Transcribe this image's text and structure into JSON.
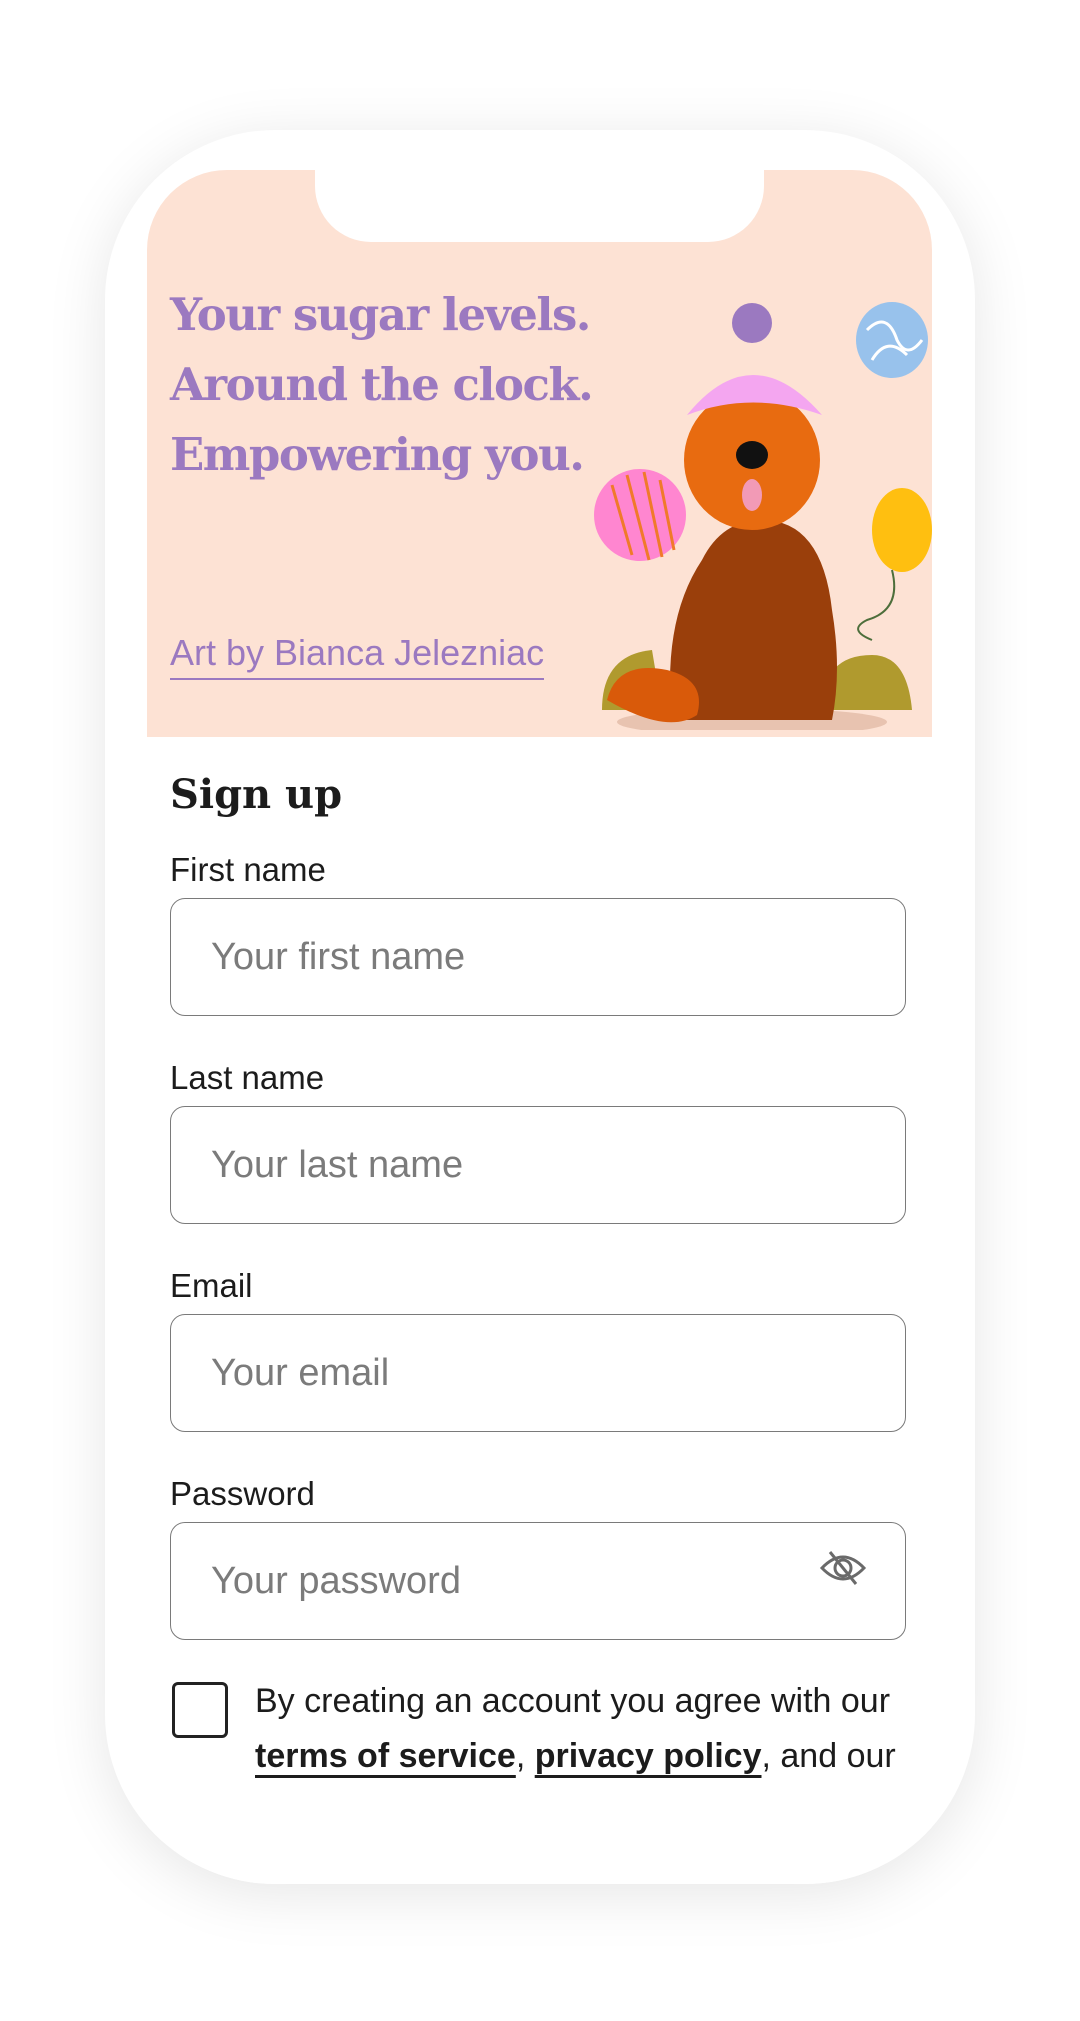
{
  "hero": {
    "headline": [
      "Your sugar levels.",
      "Around the clock.",
      "Empowering you."
    ],
    "art_credit": "Art by Bianca Jelezniac",
    "background_color": "#fde2d4",
    "accent_color": "#9b79c0"
  },
  "form": {
    "title": "Sign up",
    "fields": [
      {
        "label": "First name",
        "placeholder": "Your first name"
      },
      {
        "label": "Last name",
        "placeholder": "Your last name"
      },
      {
        "label": "Email",
        "placeholder": "Your email"
      },
      {
        "label": "Password",
        "placeholder": "Your password",
        "icon": "eye-off-icon"
      }
    ],
    "consent": {
      "checked": false,
      "text_before": "By creating an account you agree with our ",
      "terms_link": "terms of service",
      "separator": ", ",
      "privacy_link": "privacy policy",
      "text_after": ", and our"
    }
  }
}
